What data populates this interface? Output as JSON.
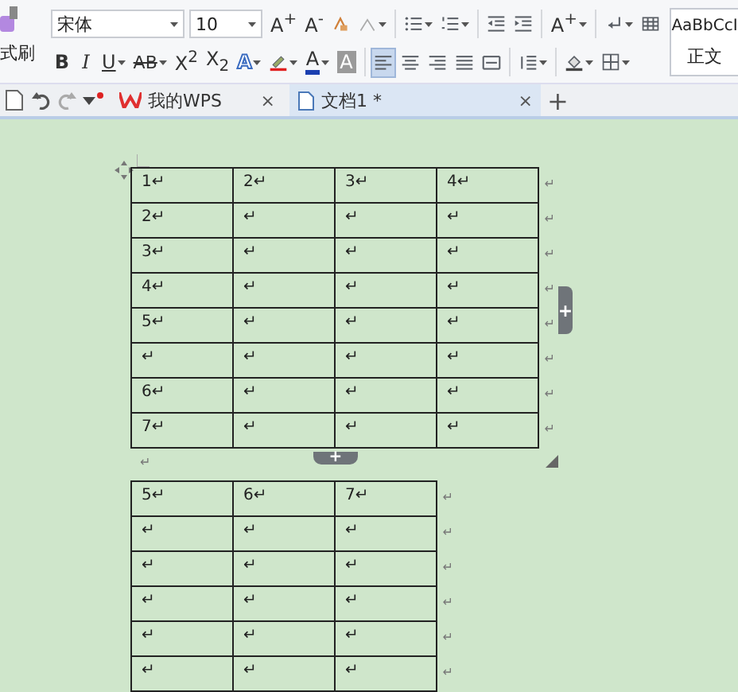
{
  "ribbon": {
    "format_painter_label": "式刷",
    "font": "宋体",
    "size": "10",
    "row1": [
      {
        "kind": "grow",
        "text": "A$^{+}$",
        "dropdown": false,
        "selected": false
      },
      {
        "kind": "shrink",
        "text": "A$^{-}$",
        "dropdown": false,
        "selected": false
      },
      {
        "kind": "clear",
        "dropdown": false,
        "selected": false
      },
      {
        "kind": "pinyin",
        "dropdown": true,
        "selected": false
      },
      {
        "kind": "sep"
      },
      {
        "kind": "bullets",
        "dropdown": true,
        "selected": false
      },
      {
        "kind": "numbering",
        "dropdown": true,
        "selected": false
      },
      {
        "kind": "sep"
      },
      {
        "kind": "outdent",
        "dropdown": false,
        "selected": false
      },
      {
        "kind": "indent",
        "dropdown": false,
        "selected": false
      },
      {
        "kind": "sep"
      },
      {
        "kind": "scale",
        "text": "A$^{+}$",
        "dropdown": true,
        "selected": false
      },
      {
        "kind": "sep"
      },
      {
        "kind": "linebreak",
        "dropdown": true,
        "selected": false
      },
      {
        "kind": "table",
        "dropdown": false,
        "selected": false
      }
    ],
    "row2": [
      {
        "kind": "bold",
        "text": "B",
        "dropdown": false,
        "selected": false
      },
      {
        "kind": "italic",
        "text": "I",
        "dropdown": false,
        "selected": false
      },
      {
        "kind": "underline",
        "text": "U",
        "dropdown": true,
        "selected": false
      },
      {
        "kind": "strike",
        "text": "AB",
        "dropdown": true,
        "selected": false
      },
      {
        "kind": "plain",
        "text": "X$^{2}$",
        "dropdown": false,
        "selected": false
      },
      {
        "kind": "plain",
        "text": "X$_{2}$",
        "dropdown": false,
        "selected": false
      },
      {
        "kind": "effect",
        "text": "A",
        "dropdown": true,
        "selected": false
      },
      {
        "kind": "highlight",
        "dropdown": true,
        "selected": false
      },
      {
        "kind": "fontcolor",
        "text": "A",
        "dropdown": true,
        "selected": false
      },
      {
        "kind": "shading",
        "text": "A",
        "dropdown": false,
        "selected": false
      },
      {
        "kind": "sep"
      },
      {
        "kind": "alignleft",
        "dropdown": false,
        "selected": true
      },
      {
        "kind": "aligncenter",
        "dropdown": false,
        "selected": false
      },
      {
        "kind": "alignright",
        "dropdown": false,
        "selected": false
      },
      {
        "kind": "justify",
        "dropdown": false,
        "selected": false
      },
      {
        "kind": "distribute",
        "dropdown": false,
        "selected": false
      },
      {
        "kind": "sep"
      },
      {
        "kind": "linespacing",
        "dropdown": true,
        "selected": false
      },
      {
        "kind": "sep"
      },
      {
        "kind": "fill",
        "dropdown": true,
        "selected": false
      },
      {
        "kind": "border",
        "dropdown": true,
        "selected": false
      }
    ],
    "style": {
      "sample": "AaBbCcI",
      "name": "正文"
    }
  },
  "tabbar": {
    "tabs": [
      {
        "label": "我的WPS",
        "selected": false,
        "close": "×"
      },
      {
        "label": "文档1 *",
        "selected": true,
        "close": "×"
      }
    ],
    "add": "+"
  },
  "document": {
    "tables": [
      {
        "add_column": "+",
        "add_row": "+",
        "rows": [
          {
            "cells": [
              "1↵",
              "2↵",
              "3↵",
              "4↵"
            ],
            "end": "↵"
          },
          {
            "cells": [
              "2↵",
              "↵",
              "↵",
              "↵"
            ],
            "end": "↵"
          },
          {
            "cells": [
              "3↵",
              "↵",
              "↵",
              "↵"
            ],
            "end": "↵"
          },
          {
            "cells": [
              "4↵",
              "↵",
              "↵",
              "↵"
            ],
            "end": "↵"
          },
          {
            "cells": [
              "5↵",
              "↵",
              "↵",
              "↵"
            ],
            "end": "↵"
          },
          {
            "cells": [
              "↵",
              "↵",
              "↵",
              "↵"
            ],
            "end": "↵"
          },
          {
            "cells": [
              "6↵",
              "↵",
              "↵",
              "↵"
            ],
            "end": "↵"
          },
          {
            "cells": [
              "7↵",
              "↵",
              "↵",
              "↵"
            ],
            "end": "↵"
          }
        ],
        "after": "↵"
      },
      {
        "rows": [
          {
            "cells": [
              "5↵",
              "6↵",
              "7↵"
            ],
            "end": "↵"
          },
          {
            "cells": [
              "↵",
              "↵",
              "↵"
            ],
            "end": "↵"
          },
          {
            "cells": [
              "↵",
              "↵",
              "↵"
            ],
            "end": "↵"
          },
          {
            "cells": [
              "↵",
              "↵",
              "↵"
            ],
            "end": "↵"
          },
          {
            "cells": [
              "↵",
              "↵",
              "↵"
            ],
            "end": "↵"
          },
          {
            "cells": [
              "↵",
              "↵",
              "↵"
            ],
            "end": "↵"
          }
        ]
      }
    ]
  }
}
